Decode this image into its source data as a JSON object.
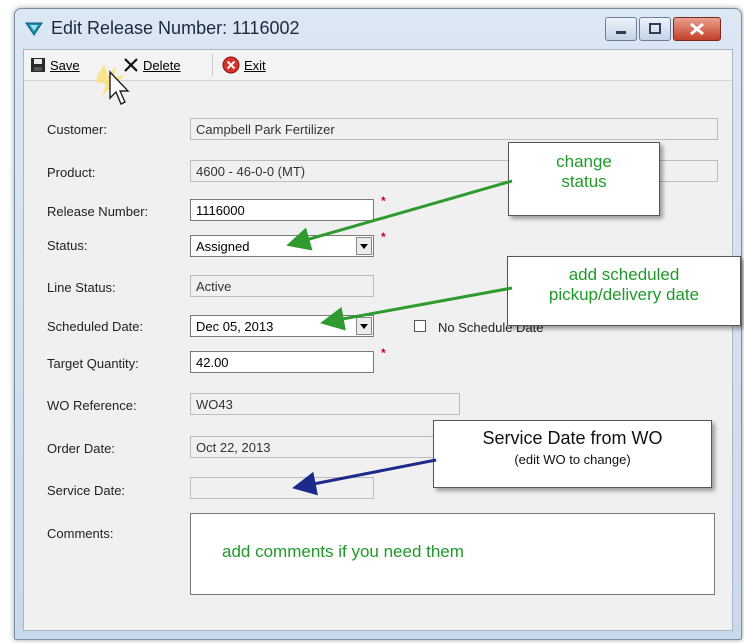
{
  "window": {
    "title": "Edit Release Number: 1116002"
  },
  "toolbar": {
    "save_label": "Save",
    "delete_label": "Delete",
    "exit_label": "Exit"
  },
  "form": {
    "customer": {
      "label": "Customer:",
      "value": "Campbell Park Fertilizer"
    },
    "product": {
      "label": "Product:",
      "value": "4600 - 46-0-0 (MT)"
    },
    "release_number": {
      "label": "Release Number:",
      "value": "1116000"
    },
    "status": {
      "label": "Status:",
      "value": "Assigned"
    },
    "line_status": {
      "label": "Line Status:",
      "value": "Active"
    },
    "scheduled_date": {
      "label": "Scheduled Date:",
      "value": "Dec 05, 2013"
    },
    "no_schedule_date": {
      "label": "No Schedule Date",
      "checked": false
    },
    "target_quantity": {
      "label": "Target Quantity:",
      "value": "42.00"
    },
    "wo_reference": {
      "label": "WO Reference:",
      "value": "WO43"
    },
    "order_date": {
      "label": "Order Date:",
      "value": "Oct 22, 2013"
    },
    "service_date": {
      "label": "Service Date:",
      "value": ""
    },
    "comments": {
      "label": "Comments:",
      "value": "add comments if you need them"
    }
  },
  "callouts": {
    "change_status": "change status",
    "scheduled_date_tip": "add scheduled pickup/delivery date",
    "service_date_title": "Service Date from WO",
    "service_date_sub": "(edit WO to change)"
  },
  "colors": {
    "annotation_green": "#1f9a2a",
    "arrow_green": "#2e9a30",
    "arrow_blue": "#1c2a8c",
    "required_red": "#d0021b"
  }
}
